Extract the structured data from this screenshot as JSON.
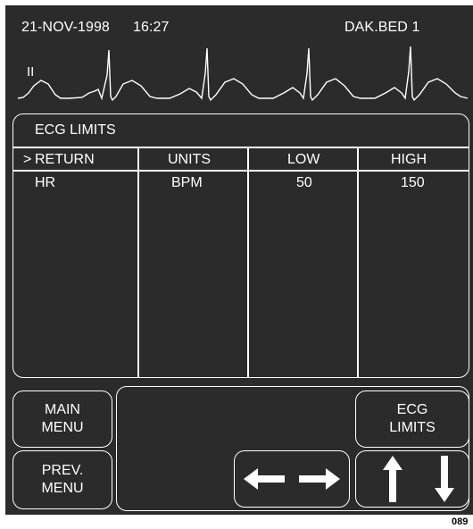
{
  "header": {
    "date": "21-NOV-1998",
    "time": "16:27",
    "bed": "DAK.BED 1"
  },
  "waveform": {
    "lead_label": "II"
  },
  "limits_panel": {
    "title": "ECG LIMITS",
    "cursor": ">",
    "columns": [
      "RETURN",
      "UNITS",
      "LOW",
      "HIGH"
    ],
    "rows": [
      {
        "param": "HR",
        "units": "BPM",
        "low": "50",
        "high": "150"
      }
    ]
  },
  "buttons": {
    "main_menu": "MAIN\nMENU",
    "prev_menu": "PREV.\nMENU",
    "ecg_limits": "ECG\nLIMITS"
  },
  "icons": {
    "horizontal_arrows": "left-right-arrows-icon",
    "vertical_arrows": "up-down-arrows-icon"
  },
  "colors": {
    "screen_background": "#2b2b2b",
    "foreground": "#ffffff"
  },
  "footer": {
    "figure_id": "089"
  }
}
